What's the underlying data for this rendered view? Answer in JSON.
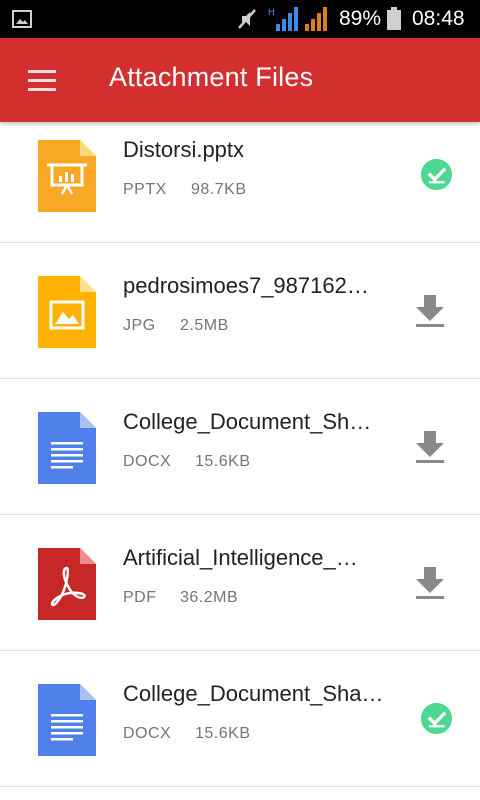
{
  "status_bar": {
    "battery_percent": "89%",
    "time": "08:48",
    "signal_label": "H"
  },
  "app_bar": {
    "title": "Attachment Files",
    "menu_icon": "hamburger-menu-icon",
    "color": "#d32f2f"
  },
  "files": [
    {
      "name": "Distorsi.pptx",
      "type": "PPTX",
      "size": "98.7KB",
      "icon": "presentation-file-icon",
      "icon_color": "#f9a825",
      "status": "downloaded"
    },
    {
      "name": "pedrosimoes7_987162…",
      "type": "JPG",
      "size": "2.5MB",
      "icon": "image-file-icon",
      "icon_color": "#ffb300",
      "status": "download"
    },
    {
      "name": "College_Document_Sh…",
      "type": "DOCX",
      "size": "15.6KB",
      "icon": "document-file-icon",
      "icon_color": "#4f7fe8",
      "status": "download"
    },
    {
      "name": "Artificial_Intelligence_…",
      "type": "PDF",
      "size": "36.2MB",
      "icon": "pdf-file-icon",
      "icon_color": "#c62828",
      "status": "download"
    },
    {
      "name": "College_Document_Shar…",
      "type": "DOCX",
      "size": "15.6KB",
      "icon": "document-file-icon",
      "icon_color": "#4f7fe8",
      "status": "downloaded"
    }
  ],
  "colors": {
    "downloaded_check": "#4cd98f",
    "download_arrow": "#8a8a8a"
  }
}
